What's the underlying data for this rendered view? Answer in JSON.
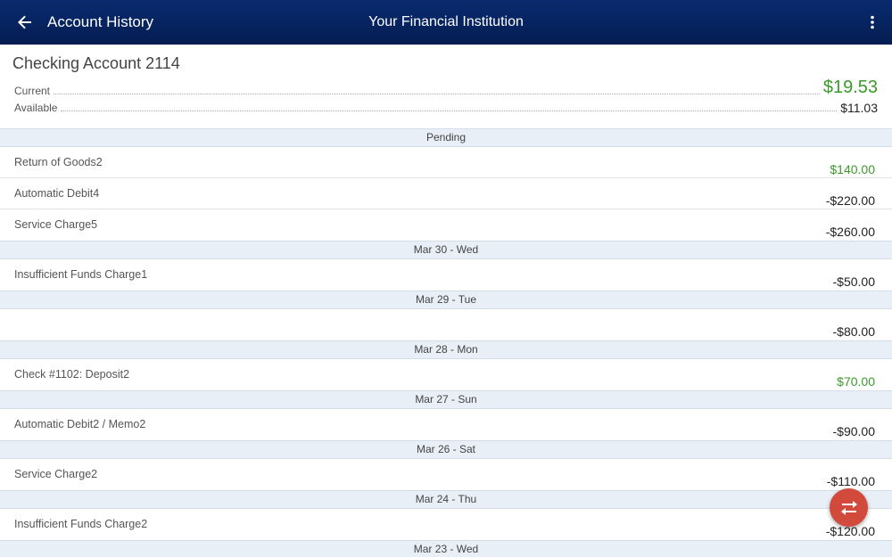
{
  "appbar": {
    "title": "Account History",
    "center_title": "Your Financial Institution",
    "back_icon": "arrow-left-icon",
    "more_icon": "more-vertical-icon"
  },
  "account": {
    "name": "Checking Account 2114",
    "current_label": "Current",
    "current_value": "$19.53",
    "available_label": "Available",
    "available_value": "$11.03"
  },
  "groups": [
    {
      "header": "Pending",
      "transactions": [
        {
          "description": "Return of Goods2",
          "amount": "$140.00",
          "positive": true
        },
        {
          "description": "Automatic Debit4",
          "amount": "-$220.00",
          "positive": false
        },
        {
          "description": "Service Charge5",
          "amount": "-$260.00",
          "positive": false
        }
      ]
    },
    {
      "header": "Mar 30 - Wed",
      "transactions": [
        {
          "description": "Insufficient Funds Charge1",
          "amount": "-$50.00",
          "positive": false
        }
      ]
    },
    {
      "header": "Mar 29 - Tue",
      "transactions": [
        {
          "description": "",
          "amount": "-$80.00",
          "positive": false
        }
      ]
    },
    {
      "header": "Mar 28 - Mon",
      "transactions": [
        {
          "description": "Check #1102: Deposit2",
          "amount": "$70.00",
          "positive": true
        }
      ]
    },
    {
      "header": "Mar 27 - Sun",
      "transactions": [
        {
          "description": "Automatic Debit2 / Memo2",
          "amount": "-$90.00",
          "positive": false
        }
      ]
    },
    {
      "header": "Mar 26 - Sat",
      "transactions": [
        {
          "description": "Service Charge2",
          "amount": "-$110.00",
          "positive": false
        }
      ]
    },
    {
      "header": "Mar 24 - Thu",
      "transactions": [
        {
          "description": "Insufficient Funds Charge2",
          "amount": "-$120.00",
          "positive": false
        }
      ]
    },
    {
      "header": "Mar 23 - Wed",
      "transactions": []
    }
  ],
  "fab": {
    "icon": "transfer-icon",
    "color": "#d24a3c"
  },
  "colors": {
    "appbar": "#06235e",
    "positive": "#3a9a2a",
    "section_bg": "#e8eff7"
  }
}
